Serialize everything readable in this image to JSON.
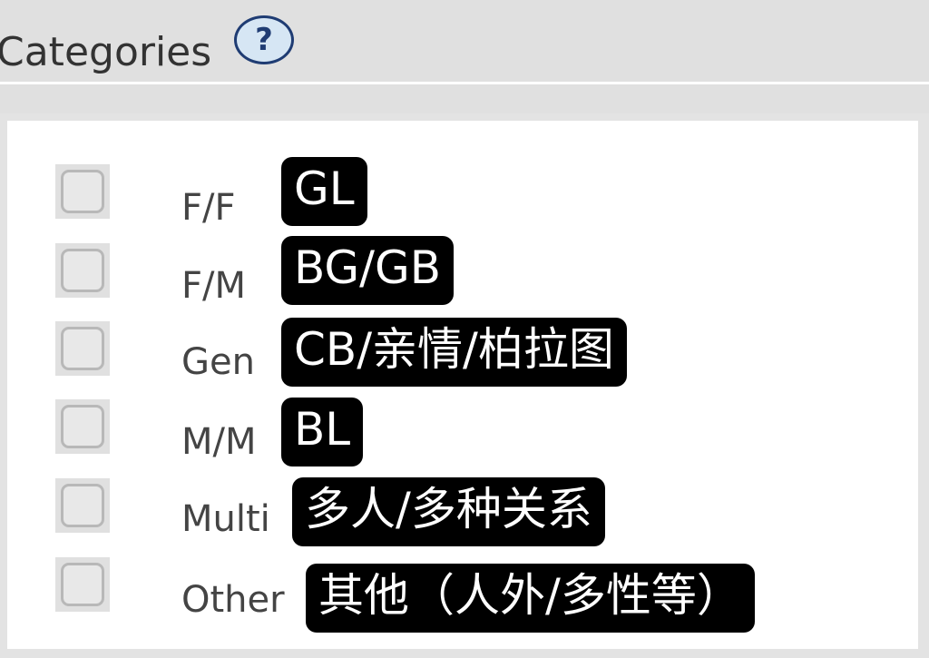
{
  "header": {
    "title": "Categories",
    "help_label": "?"
  },
  "categories": [
    {
      "label": "F/F",
      "tag": "GL",
      "checked": false
    },
    {
      "label": "F/M",
      "tag": "BG/GB",
      "checked": false
    },
    {
      "label": "Gen",
      "tag": "CB/亲情/柏拉图",
      "checked": false
    },
    {
      "label": "M/M",
      "tag": "BL",
      "checked": false
    },
    {
      "label": "Multi",
      "tag": "多人/多种关系",
      "checked": false
    },
    {
      "label": "Other",
      "tag": "其他（人外/多性等）",
      "checked": false
    }
  ]
}
